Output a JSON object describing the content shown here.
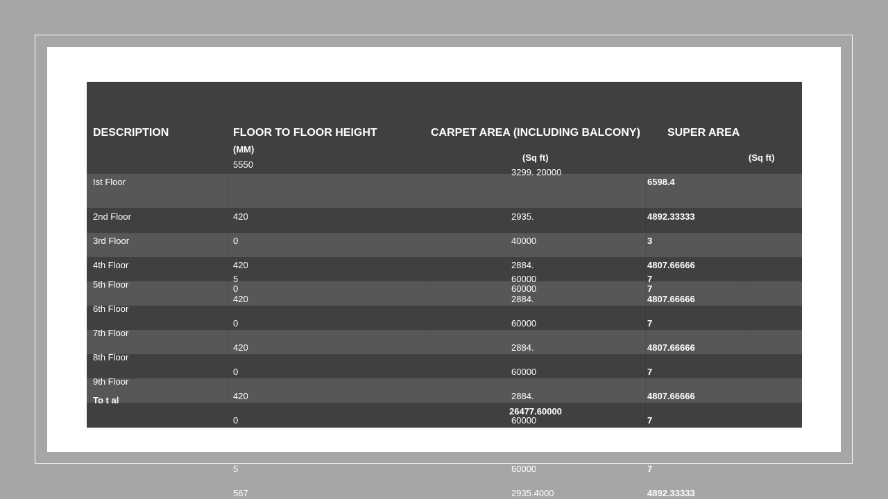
{
  "table": {
    "headers": {
      "description": "DESCRIPTION",
      "floor_height": "FLOOR TO FLOOR HEIGHT",
      "floor_height_unit": "(MM)",
      "carpet_area": "CARPET AREA (INCLUDING BALCONY)",
      "carpet_area_unit": "(Sq ft)",
      "super_area": "SUPER AREA",
      "super_area_unit": "(Sq ft)"
    },
    "floors": [
      "Ist Floor",
      "2nd Floor",
      "3rd Floor",
      "4th Floor",
      "5th Floor",
      "6th Floor",
      "7th Floor",
      "8th Floor",
      "9th Floor"
    ],
    "total_label": "To t al",
    "height_values": [
      "5550",
      "420",
      "0",
      "420",
      "5",
      "0",
      "420",
      "0",
      "420",
      "0",
      "420",
      "0",
      "5",
      "567"
    ],
    "carpet_values": [
      "3299. 20000",
      "2935.",
      "40000",
      "2884.",
      "60000",
      "60000",
      "2884.",
      "60000",
      "2884.",
      "60000",
      "2884.",
      "60000",
      "60000",
      "2935.4000"
    ],
    "carpet_total": "26477.60000",
    "super_values": [
      "6598.4",
      "4892.33333",
      "3",
      "4807.66666",
      "7",
      "7",
      "4807.66666",
      "7",
      "4807.66666",
      "7",
      "4807.66666",
      "7",
      "7",
      "4892.33333"
    ]
  }
}
